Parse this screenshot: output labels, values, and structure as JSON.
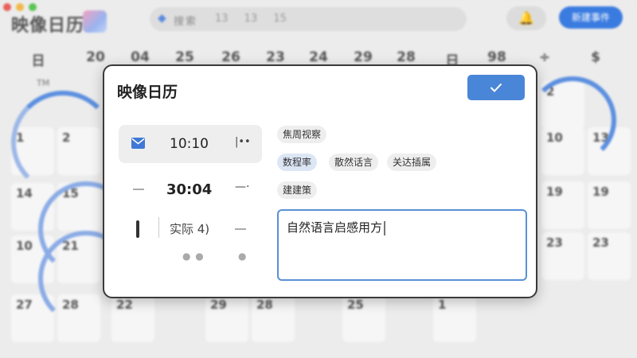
{
  "background": {
    "app_title": "映像日历",
    "search_label": "搜索",
    "search_numbers": "13 13 15",
    "bell_icon": "bell-icon",
    "action_button": "新建事件",
    "weekday_headers": [
      "日",
      "20",
      "04",
      "25",
      "26",
      "23",
      "24",
      "29",
      "28",
      "日",
      "98",
      "÷",
      "$"
    ],
    "calendar_cells": [
      "1",
      "2",
      "2",
      "10",
      "13",
      "14",
      "15",
      "19",
      "19",
      "10",
      "21",
      "23",
      "23",
      "27",
      "28",
      "22",
      "29",
      "28",
      "25",
      "1"
    ],
    "corner_label": "TM"
  },
  "dialog": {
    "title": "映像日历",
    "confirm_icon": "check-icon",
    "rows": [
      {
        "icon": "mail-icon",
        "value": "10:10",
        "right": "|••"
      },
      {
        "value": "30:04",
        "right": "—·"
      },
      {
        "value": "实际 4)"
      }
    ],
    "tags_row1": [
      "焦周视察"
    ],
    "tags_row2": [
      "数程率",
      "散然话言",
      "关达插属"
    ],
    "tags_row3": [
      "建建策"
    ],
    "text_value": "自然语言启感用方"
  },
  "colors": {
    "accent": "#4a86d8",
    "selected_tag": "#dce6f5"
  }
}
